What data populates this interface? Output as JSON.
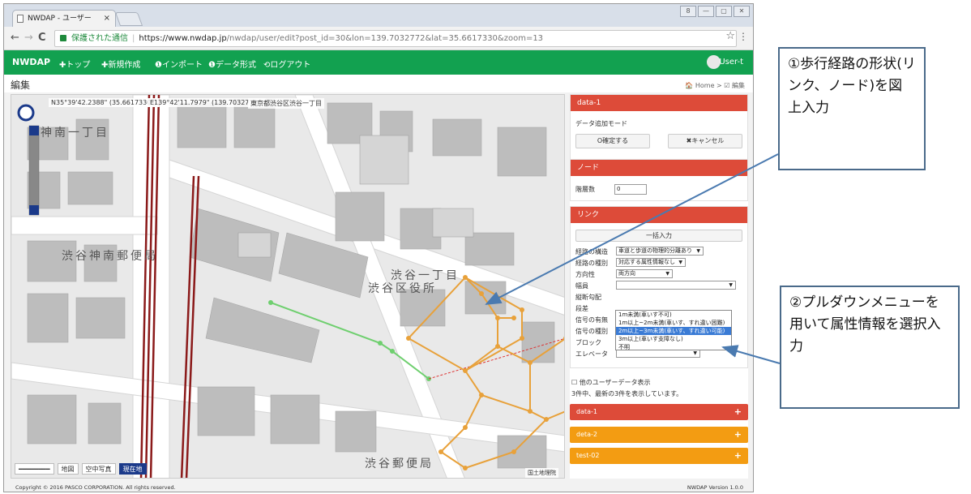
{
  "browser": {
    "tab_title": "NWDAP - ユーザー",
    "tab_close": "×",
    "win_buttons": [
      "8",
      "—",
      "▢",
      "✕"
    ],
    "nav": {
      "back": "←",
      "forward": "→",
      "reload": "C"
    },
    "url": {
      "secure_label": "保護された通信",
      "host": "https://www.nwdap.jp",
      "path": "/nwdap/user/edit?post_id=30&lon=139.7032772&lat=35.6617330&zoom=13"
    },
    "bookmark": "☆",
    "menu": "⋮"
  },
  "app_nav": {
    "brand": "NWDAP",
    "items": [
      "✚トップ",
      "✚新規作成",
      "❶インポート",
      "❶データ形式",
      "⟲ログアウト"
    ],
    "user": "User-t"
  },
  "page": {
    "title": "編集",
    "breadcrumb": "🏠 Home > ☑ 編集"
  },
  "map": {
    "coord_lat": "N35°39'42.2388\" (35.6617330°)",
    "coord_lon": "E139°42'11.7979\" (139.7032772°)",
    "address": "東京都渋谷区渋谷一丁目",
    "labels": [
      "神南一丁目",
      "渋谷神南郵便局",
      "渋谷一丁目",
      "渋谷区役所",
      "渋谷郵便局"
    ],
    "attribution": "国土地理院",
    "controls": [
      "地図",
      "空中写真",
      "現在地"
    ],
    "active_control": "現在地"
  },
  "panel_data1": {
    "header": "data-1",
    "mode": "データ追加モード",
    "confirm": "O確定する",
    "cancel": "✖キャンセル"
  },
  "panel_node": {
    "header": "ノード",
    "floor_label": "階層数",
    "floor_value": "0"
  },
  "panel_link": {
    "header": "リンク",
    "bulk_button": "一括入力",
    "fields": [
      {
        "label": "経路の構造",
        "value": "車道と歩道の物理的分離あり"
      },
      {
        "label": "経路の種別",
        "value": "対応する属性情報なし"
      },
      {
        "label": "方向性",
        "value": "両方向"
      },
      {
        "label": "幅員",
        "value": ""
      },
      {
        "label": "縦断勾配",
        "value": ""
      },
      {
        "label": "段差",
        "value": ""
      },
      {
        "label": "信号の有無",
        "value": ""
      },
      {
        "label": "信号の種別",
        "value": ""
      },
      {
        "label": "ブロック",
        "value": ""
      },
      {
        "label": "エレベータ",
        "value": ""
      }
    ],
    "dropdown_options": [
      "1m未満(車いす不可)",
      "1m以上~2m未満(車いす、すれ違い困難)",
      "2m以上~3m未満(車いす、すれ違い可能)",
      "3m以上(車いす支障なし)",
      "不明"
    ],
    "dropdown_highlighted": "2m以上~3m未満(車いす、すれ違い可能)"
  },
  "other_users": {
    "checkbox_label": "他のユーザーデータ表示",
    "result_text": "3件中、最新の3件を表示しています。"
  },
  "collapsed_panels": [
    {
      "label": "data-1",
      "color": "#dd4b39"
    },
    {
      "label": "deta-2",
      "color": "#f39c12"
    },
    {
      "label": "test-02",
      "color": "#f39c12"
    }
  ],
  "footer": {
    "copyright": "Copyright © 2016 PASCO CORPORATION. All rights reserved.",
    "version": "NWDAP Version 1.0.0"
  },
  "annotations": {
    "callout1": "①歩行経路の形状(リンク、ノード)を図上入力",
    "callout2": "②プルダウンメニューを用いて属性情報を選択入力"
  },
  "colors": {
    "nav_green": "#12a150",
    "panel_red": "#dd4b39",
    "panel_orange": "#f39c12",
    "route_orange": "#e8a13a",
    "route_green": "#6fcf6f",
    "rail": "#8b1a1a"
  }
}
